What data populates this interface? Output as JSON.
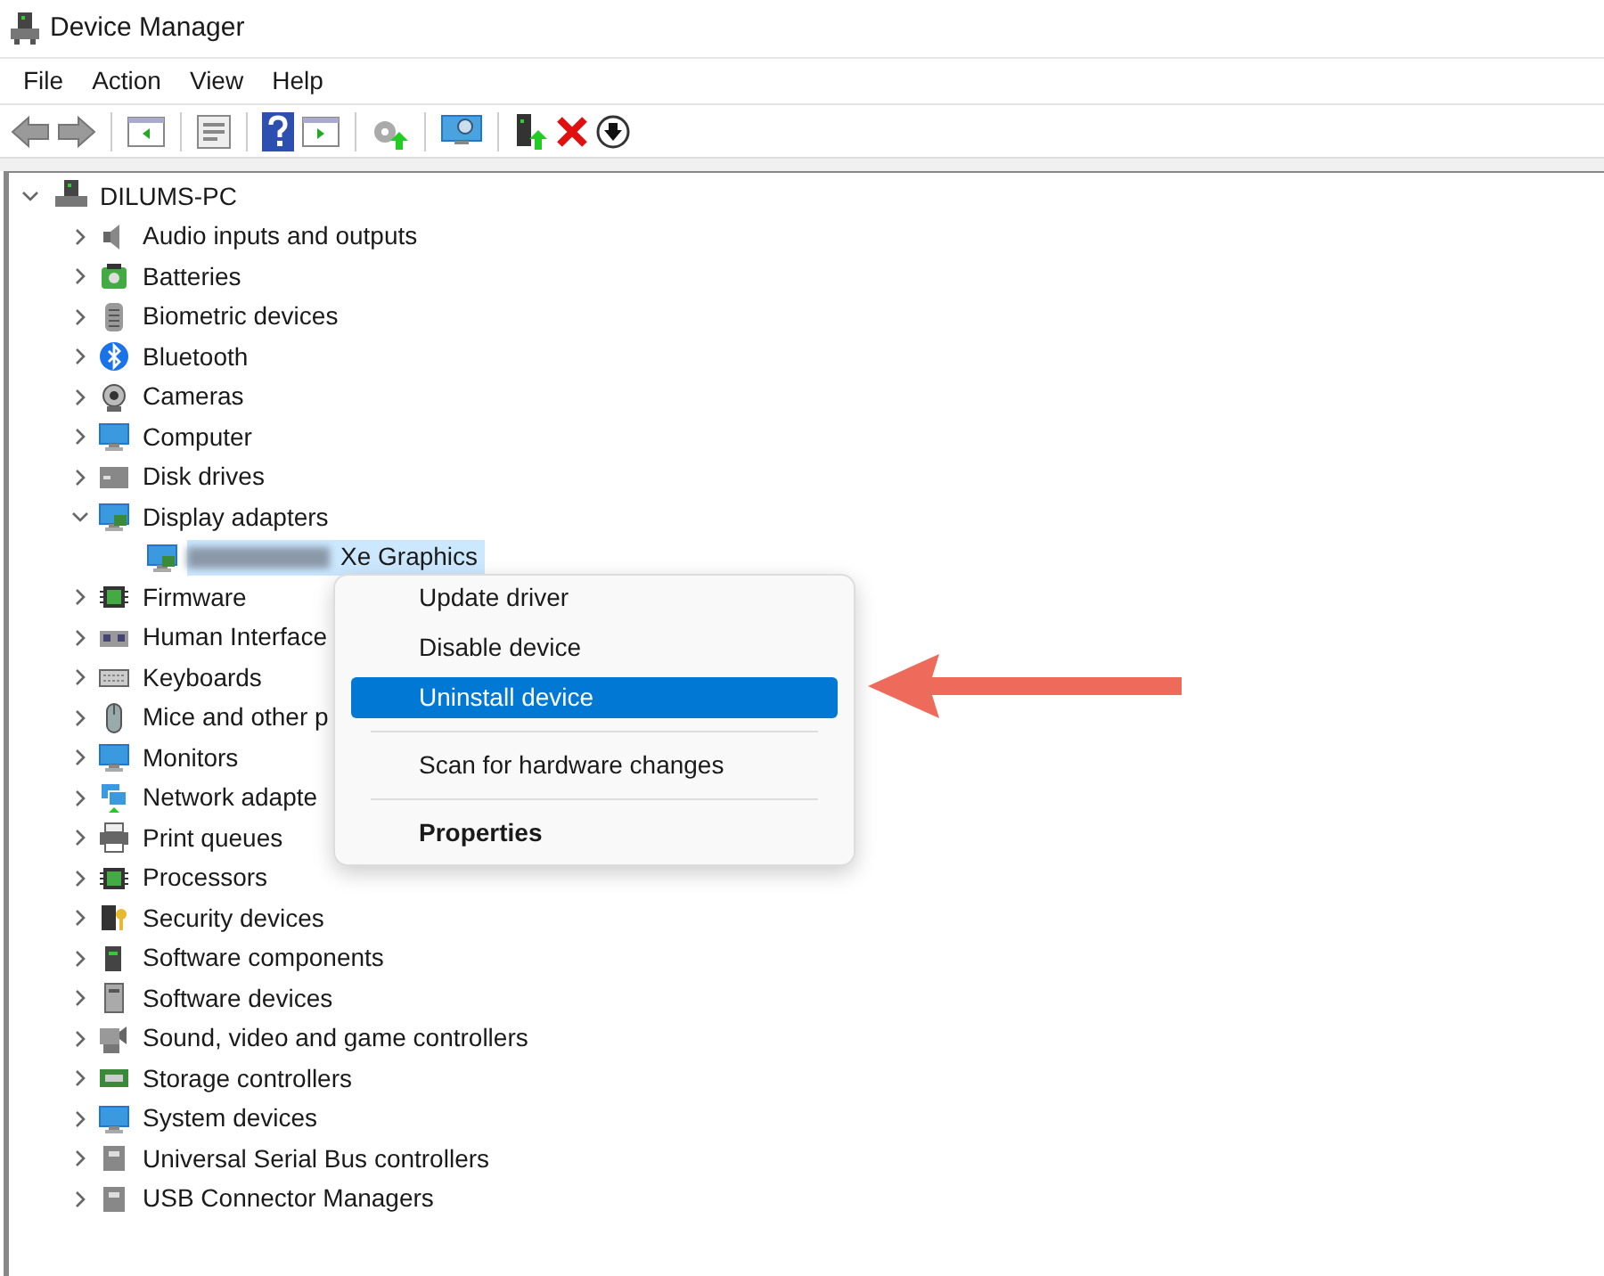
{
  "window": {
    "title": "Device Manager"
  },
  "menu_bar": [
    "File",
    "Action",
    "View",
    "Help"
  ],
  "tree": {
    "label": "DILUMS-PC",
    "expanded": true,
    "selected": false,
    "children": [
      {
        "label": "Audio inputs and outputs",
        "expanded": false,
        "selected": false
      },
      {
        "label": "Batteries",
        "expanded": false,
        "selected": false
      },
      {
        "label": "Biometric devices",
        "expanded": false,
        "selected": false
      },
      {
        "label": "Bluetooth",
        "expanded": false,
        "selected": false
      },
      {
        "label": "Cameras",
        "expanded": false,
        "selected": false
      },
      {
        "label": "Computer",
        "expanded": false,
        "selected": false
      },
      {
        "label": "Disk drives",
        "expanded": false,
        "selected": false
      },
      {
        "label": "Display adapters",
        "expanded": true,
        "selected": false,
        "children": [
          {
            "label": "Xe Graphics",
            "redacted": true,
            "selected": true
          }
        ]
      },
      {
        "label": "Firmware",
        "expanded": false,
        "selected": false
      },
      {
        "label": "Human Interface",
        "expanded": false,
        "selected": false
      },
      {
        "label": "Keyboards",
        "expanded": false,
        "selected": false
      },
      {
        "label": "Mice and other p",
        "expanded": false,
        "selected": false
      },
      {
        "label": "Monitors",
        "expanded": false,
        "selected": false
      },
      {
        "label": "Network adapte",
        "expanded": false,
        "selected": false
      },
      {
        "label": "Print queues",
        "expanded": false,
        "selected": false
      },
      {
        "label": "Processors",
        "expanded": false,
        "selected": false
      },
      {
        "label": "Security devices",
        "expanded": false,
        "selected": false
      },
      {
        "label": "Software components",
        "expanded": false,
        "selected": false
      },
      {
        "label": "Software devices",
        "expanded": false,
        "selected": false
      },
      {
        "label": "Sound, video and game controllers",
        "expanded": false,
        "selected": false
      },
      {
        "label": "Storage controllers",
        "expanded": false,
        "selected": false
      },
      {
        "label": "System devices",
        "expanded": false,
        "selected": false
      },
      {
        "label": "Universal Serial Bus controllers",
        "expanded": false,
        "selected": false
      },
      {
        "label": "USB Connector Managers",
        "expanded": false,
        "selected": false
      }
    ]
  },
  "context_menu": [
    {
      "label": "Update driver",
      "selected": false,
      "default": false,
      "separator_before": false
    },
    {
      "label": "Disable device",
      "selected": false,
      "default": false,
      "separator_before": false
    },
    {
      "label": "Uninstall device",
      "selected": true,
      "default": false,
      "separator_before": false
    },
    {
      "label": "Scan for hardware changes",
      "selected": false,
      "default": false,
      "separator_before": true
    },
    {
      "label": "Properties",
      "selected": false,
      "default": true,
      "separator_before": true
    }
  ]
}
